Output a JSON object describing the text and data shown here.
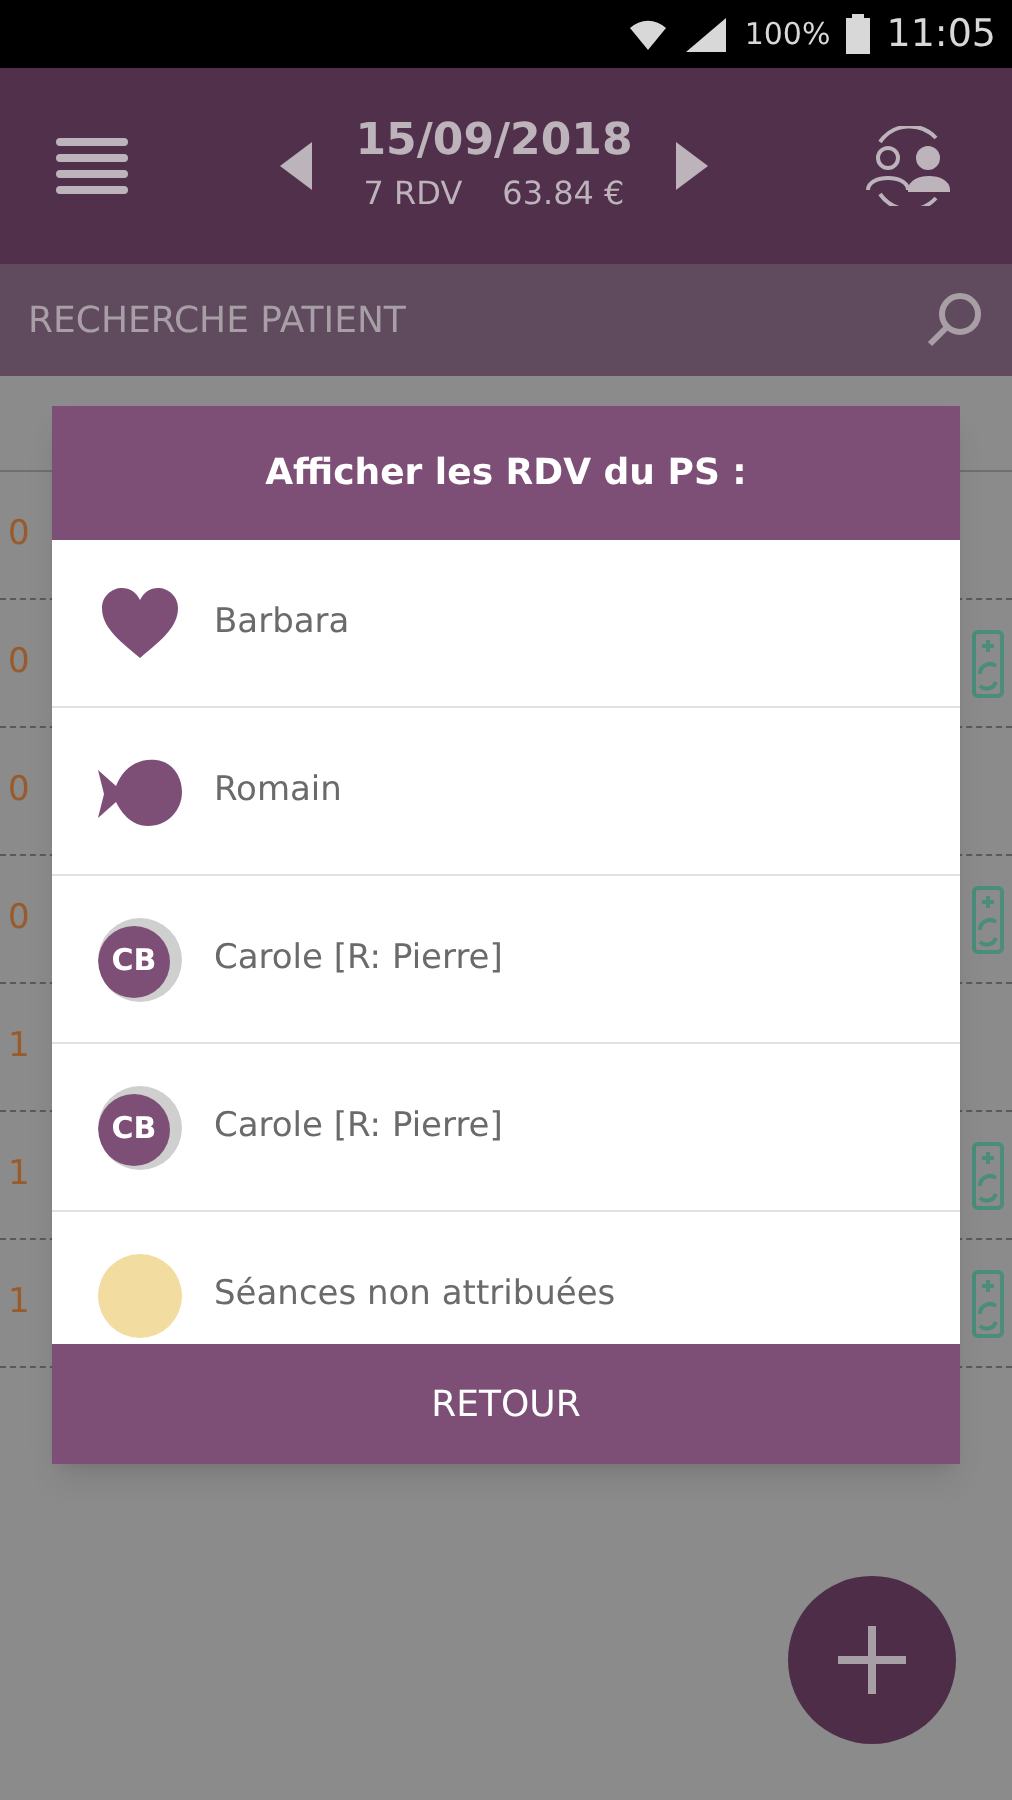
{
  "status_bar": {
    "battery": "100%",
    "time": "11:05"
  },
  "app_bar": {
    "date": "15/09/2018",
    "count": "7 RDV",
    "amount": "63.84 €"
  },
  "search": {
    "placeholder": "RECHERCHE PATIENT"
  },
  "agenda_rows": [
    {
      "time": "0",
      "action": false
    },
    {
      "time": "0",
      "action": true
    },
    {
      "time": "0",
      "action": false
    },
    {
      "time": "0",
      "action": true
    },
    {
      "time": "1",
      "action": false
    },
    {
      "time": "1",
      "action": true
    },
    {
      "time": "1",
      "action": true
    }
  ],
  "dialog": {
    "title": "Afficher les RDV du PS :",
    "items": [
      {
        "kind": "heart",
        "name": "Barbara"
      },
      {
        "kind": "fish",
        "name": "Romain"
      },
      {
        "kind": "initials",
        "initials": "CB",
        "name": "Carole [R: Pierre]"
      },
      {
        "kind": "initials",
        "initials": "CB",
        "name": "Carole [R: Pierre]"
      },
      {
        "kind": "blank",
        "name": "Séances non attribuées"
      }
    ],
    "button": "RETOUR"
  }
}
